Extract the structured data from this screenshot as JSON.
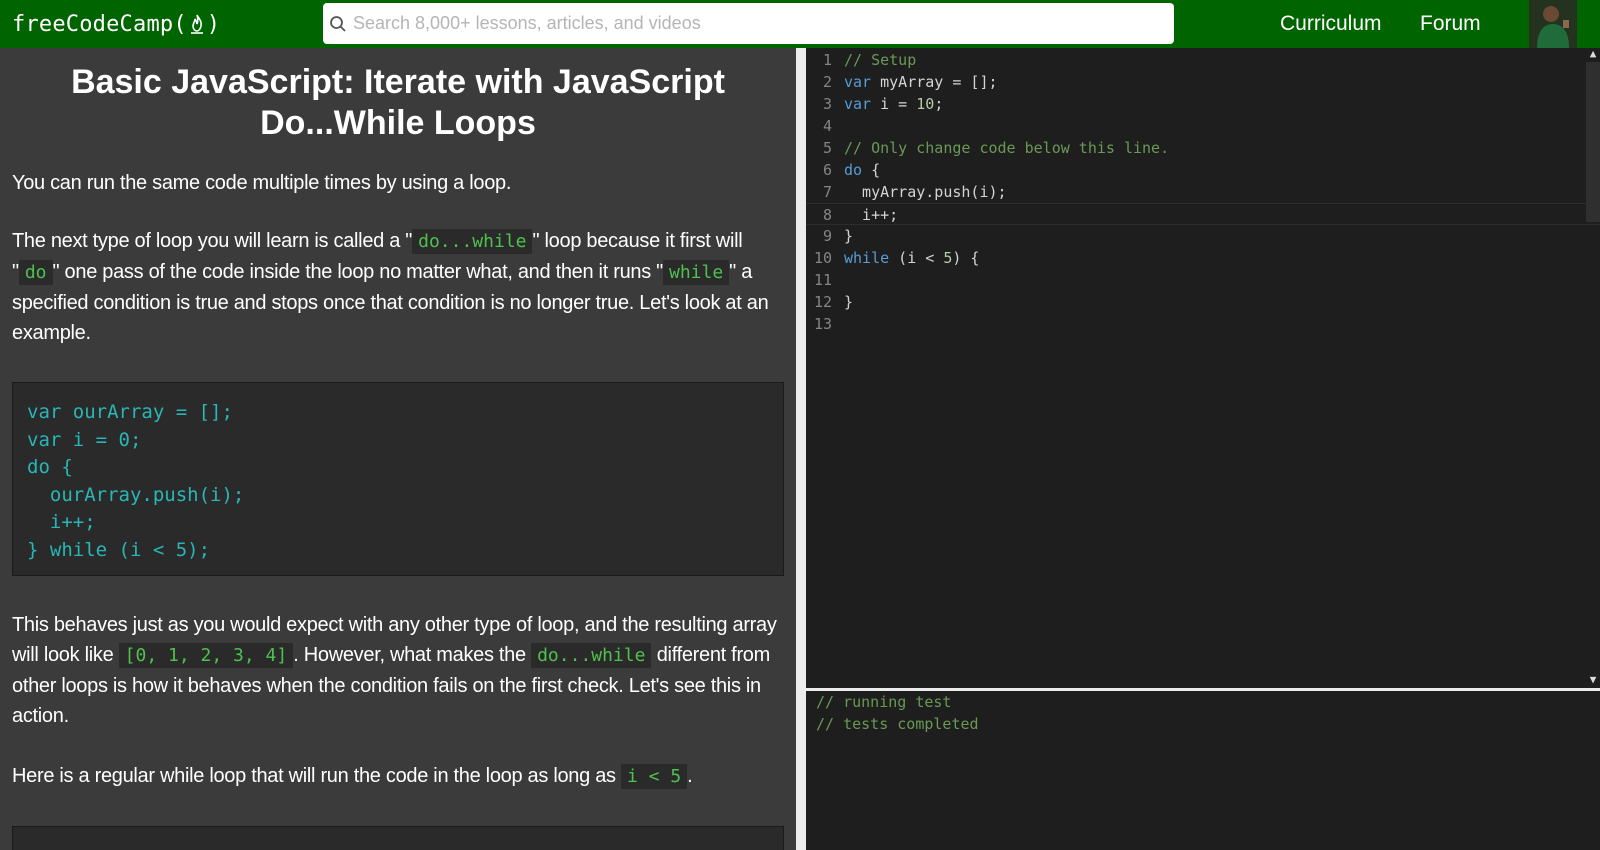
{
  "navbar": {
    "logo_left": "freeCodeCamp(",
    "logo_right": ")",
    "search_placeholder": "Search 8,000+ lessons, articles, and videos",
    "links": [
      "Curriculum",
      "Forum"
    ]
  },
  "lesson": {
    "title": "Basic JavaScript: Iterate with JavaScript Do...While Loops",
    "p1": "You can run the same code multiple times by using a loop.",
    "p2_a": "The next type of loop you will learn is called a \"",
    "p2_code1": "do...while",
    "p2_b": "\" loop because it first will \"",
    "p2_code2": "do",
    "p2_c": "\" one pass of the code inside the loop no matter what, and then it runs \"",
    "p2_code3": "while",
    "p2_d": "\" a specified condition is true and stops once that condition is no longer true. Let's look at an example.",
    "example_code": "var ourArray = [];\nvar i = 0;\ndo {\n  ourArray.push(i);\n  i++;\n} while (i < 5);",
    "p3_a": "This behaves just as you would expect with any other type of loop, and the resulting array will look like ",
    "p3_code1": "[0, 1, 2, 3, 4]",
    "p3_b": ". However, what makes the ",
    "p3_code2": "do...while",
    "p3_c": " different from other loops is how it behaves when the condition fails on the first check. Let's see this in action.",
    "p4_a": "Here is a regular while loop that will run the code in the loop as long as ",
    "p4_code": "i < 5",
    "p4_b": "."
  },
  "editor": {
    "lines": [
      {
        "num": "1",
        "parts": [
          [
            "c",
            "// Setup"
          ]
        ]
      },
      {
        "num": "2",
        "parts": [
          [
            "k",
            "var"
          ],
          [
            "v",
            " myArray = [];"
          ]
        ]
      },
      {
        "num": "3",
        "parts": [
          [
            "k",
            "var"
          ],
          [
            "v",
            " i = "
          ],
          [
            "n",
            "10"
          ],
          [
            "v",
            ";"
          ]
        ]
      },
      {
        "num": "4",
        "parts": []
      },
      {
        "num": "5",
        "parts": [
          [
            "c",
            "// Only change code below this line."
          ]
        ]
      },
      {
        "num": "6",
        "parts": [
          [
            "k",
            "do"
          ],
          [
            "v",
            " {"
          ]
        ]
      },
      {
        "num": "7",
        "parts": [
          [
            "v",
            "  myArray.push(i);"
          ]
        ]
      },
      {
        "num": "8",
        "parts": [
          [
            "v",
            "  i++;"
          ]
        ]
      },
      {
        "num": "9",
        "parts": [
          [
            "v",
            "}"
          ]
        ]
      },
      {
        "num": "10",
        "parts": [
          [
            "k",
            "while"
          ],
          [
            "v",
            " (i < "
          ],
          [
            "n",
            "5"
          ],
          [
            "v",
            ") {"
          ]
        ]
      },
      {
        "num": "11",
        "parts": []
      },
      {
        "num": "12",
        "parts": [
          [
            "v",
            "}"
          ]
        ]
      },
      {
        "num": "13",
        "parts": []
      }
    ]
  },
  "output": {
    "lines": [
      "// running test",
      "// tests completed"
    ]
  }
}
